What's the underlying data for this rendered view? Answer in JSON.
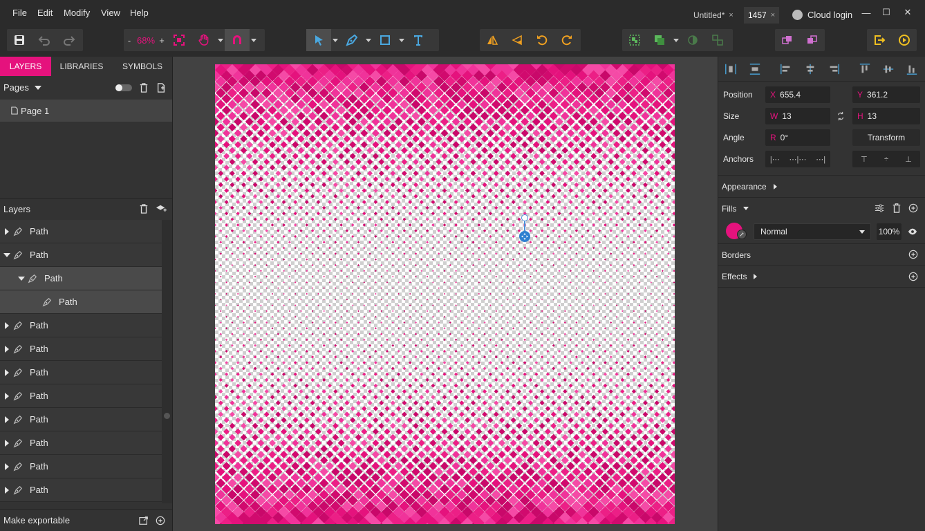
{
  "menu": {
    "file": "File",
    "edit": "Edit",
    "modify": "Modify",
    "view": "View",
    "help": "Help"
  },
  "tabs": [
    {
      "label": "Untitled*",
      "close": "×"
    },
    {
      "label": "1457",
      "close": "×"
    }
  ],
  "cloud_login": "Cloud login",
  "window": {
    "minimize": "—",
    "maximize": "☐",
    "close": "✕"
  },
  "toolbar": {
    "zoom_minus": "-",
    "zoom": "68%",
    "zoom_plus": "+"
  },
  "left": {
    "tabs": [
      "LAYERS",
      "LIBRARIES",
      "SYMBOLS"
    ],
    "pages_label": "Pages",
    "page_item": "Page 1",
    "layers_label": "Layers",
    "layers": [
      {
        "label": "Path",
        "level": 0,
        "expanded": false
      },
      {
        "label": "Path",
        "level": 0,
        "expanded": true
      },
      {
        "label": "Path",
        "level": 1,
        "expanded": true
      },
      {
        "label": "Path",
        "level": 2,
        "expanded": null
      },
      {
        "label": "Path",
        "level": 0,
        "expanded": false
      },
      {
        "label": "Path",
        "level": 0,
        "expanded": false
      },
      {
        "label": "Path",
        "level": 0,
        "expanded": false
      },
      {
        "label": "Path",
        "level": 0,
        "expanded": false
      },
      {
        "label": "Path",
        "level": 0,
        "expanded": false
      },
      {
        "label": "Path",
        "level": 0,
        "expanded": false
      },
      {
        "label": "Path",
        "level": 0,
        "expanded": false
      },
      {
        "label": "Path",
        "level": 0,
        "expanded": false
      }
    ],
    "make_exportable": "Make exportable"
  },
  "right": {
    "position_label": "Position",
    "x_prefix": "X",
    "x": "655.4",
    "y_prefix": "Y",
    "y": "361.2",
    "size_label": "Size",
    "w_prefix": "W",
    "w": "13",
    "h_prefix": "H",
    "h": "13",
    "angle_label": "Angle",
    "r_prefix": "R",
    "angle": "0°",
    "transform": "Transform",
    "anchors_label": "Anchors",
    "appearance": "Appearance",
    "fills": "Fills",
    "blend_mode": "Normal",
    "opacity": "100%",
    "borders": "Borders",
    "effects": "Effects"
  },
  "colors": {
    "accent": "#e5127d",
    "panel": "#333333",
    "bar": "#2b2b2b",
    "canvas": "#424242"
  }
}
